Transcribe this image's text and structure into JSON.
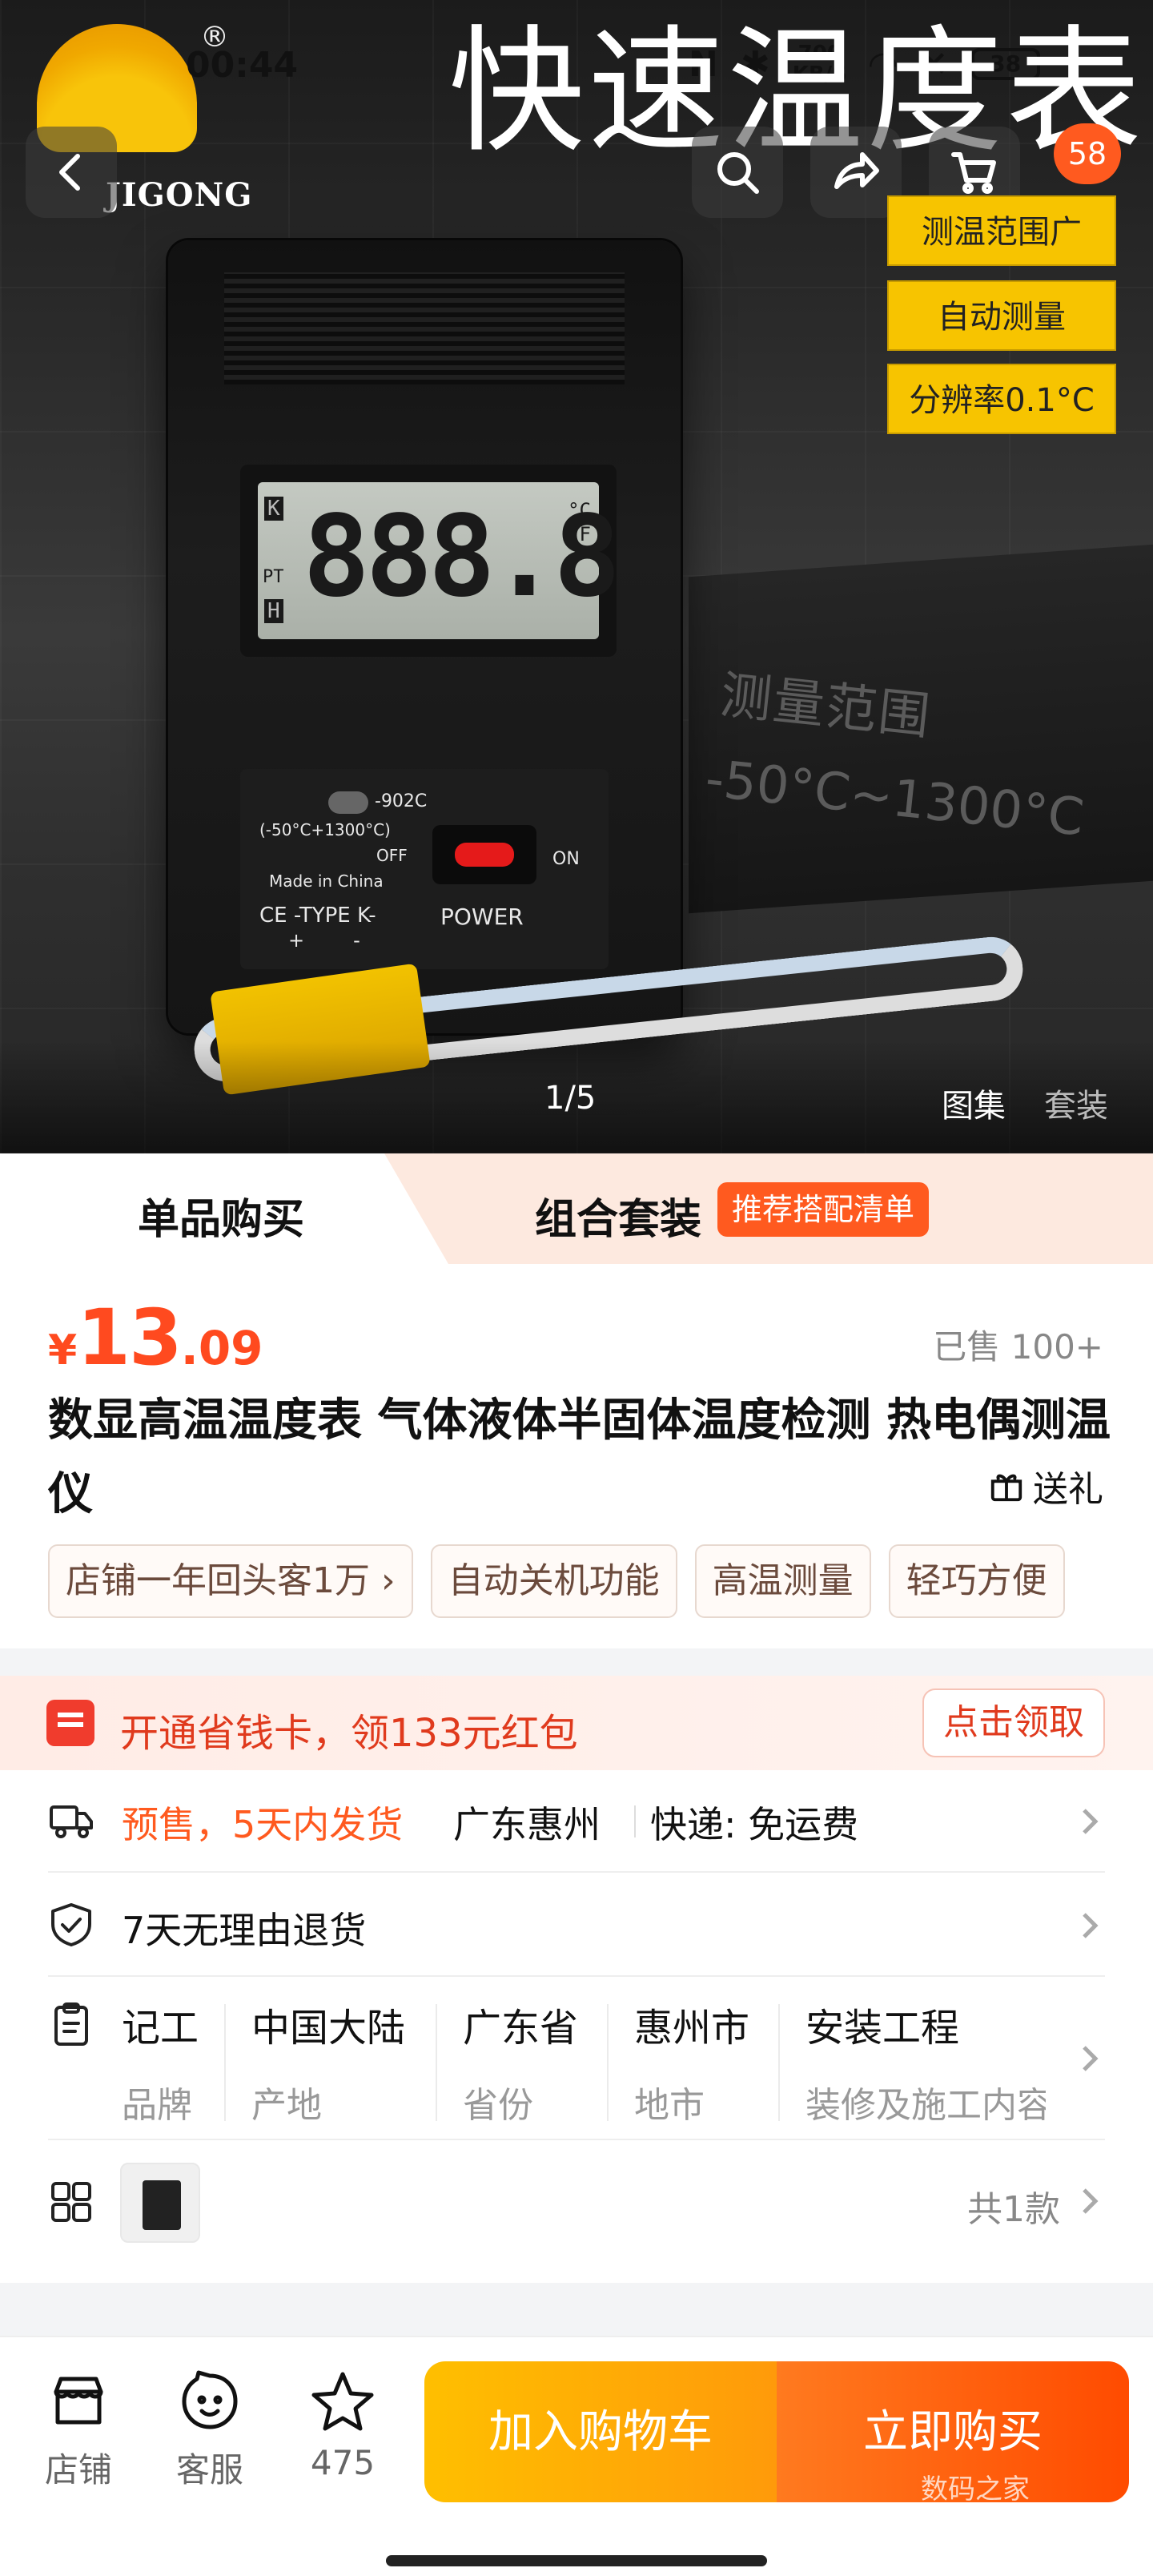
{
  "status_bar": {
    "time": "00:44",
    "net_speed": "700",
    "net_unit": "KB/S",
    "battery": "38"
  },
  "hero": {
    "brand_name": "JIGONG",
    "registered_mark": "®",
    "banner_title": "快速温度表",
    "cart_badge": "58",
    "features": [
      "测温范围广",
      "自动测量",
      "分辨率0.1°C"
    ],
    "block_text": [
      "测量范围",
      "-50°C~1300°C"
    ],
    "device": {
      "lcd_digits": "888.8",
      "lcd_k": "K",
      "lcd_pt": "PT",
      "lcd_h": "H",
      "lcd_units": "°C\n°F",
      "model": "-902C",
      "range": "(-50°C+1300°C)",
      "off": "OFF",
      "on": "ON",
      "made_in": "Made in China",
      "type": "CE -TYPE K-",
      "polarity": "+        -",
      "power": "POWER"
    },
    "pager": "1/5",
    "gallery_tab": "图集",
    "bundle_tab": "套装"
  },
  "tabs": {
    "single": "单品购买",
    "combo": "组合套装",
    "combo_badge": "推荐搭配清单"
  },
  "product": {
    "price_currency": "¥",
    "price_int": "13",
    "price_dec": ".09",
    "sold": "已售 100+",
    "title": "数显高温温度表 气体液体半固体温度检测 热电偶测温仪",
    "gift": "送礼",
    "chips": [
      "店铺一年回头客1万 ›",
      "自动关机功能",
      "高温测量",
      "轻巧方便"
    ]
  },
  "coupon": {
    "text": "开通省钱卡，领133元红包",
    "button": "点击领取"
  },
  "delivery": {
    "presale": "预售，5天内发货",
    "location": "广东惠州",
    "shipping": "快递: 免运费"
  },
  "returns": {
    "text": "7天无理由退货"
  },
  "specs": [
    {
      "value": "记工",
      "key": "品牌"
    },
    {
      "value": "中国大陆",
      "key": "产地"
    },
    {
      "value": "广东省",
      "key": "省份"
    },
    {
      "value": "惠州市",
      "key": "地市"
    },
    {
      "value": "安装工程",
      "key": "装修及施工内容"
    }
  ],
  "variants": {
    "count": "共1款"
  },
  "bottom_bar": {
    "store": "店铺",
    "service": "客服",
    "favorites": "475",
    "add_to_cart": "加入购物车",
    "buy_now": "立即购买",
    "watermark": "数码之家"
  }
}
